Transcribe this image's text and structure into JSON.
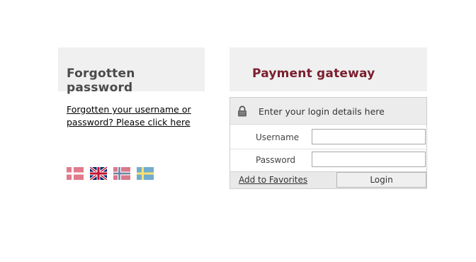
{
  "forgotten": {
    "heading": "Forgotten password",
    "link_text": "Forgotten your username or password? Please click here"
  },
  "languages": [
    {
      "icon": "denmark-flag-icon",
      "selected": false
    },
    {
      "icon": "uk-flag-icon",
      "selected": true
    },
    {
      "icon": "norway-flag-icon",
      "selected": false
    },
    {
      "icon": "sweden-flag-icon",
      "selected": false
    }
  ],
  "payment": {
    "heading": "Payment gateway",
    "login_prompt": "Enter your login details here",
    "username_label": "Username",
    "username_value": "",
    "password_label": "Password",
    "password_value": "",
    "favorites_label": "Add to Favorites",
    "login_button": "Login"
  },
  "colors": {
    "panel_bg": "#f0f0f0",
    "payment_heading": "#7a1f2e",
    "forgotten_heading": "#4a4a4a"
  }
}
